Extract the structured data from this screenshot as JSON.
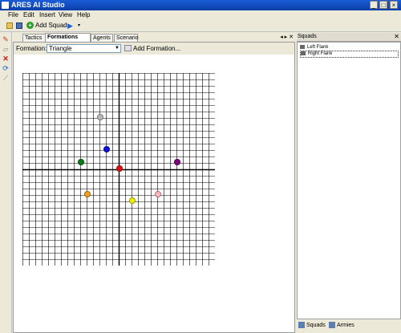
{
  "window": {
    "title": "ARES AI Studio"
  },
  "menu": [
    "File",
    "Edit",
    "Insert",
    "View",
    "Help"
  ],
  "toolbar": {
    "open_icon": "folder-open-icon",
    "save_icon": "save-icon",
    "add_squad": "Add Squad",
    "play_icon": "play-icon"
  },
  "tabs": [
    "Tactics",
    "Formations",
    "Agents",
    "Scenario"
  ],
  "active_tab": "Formations",
  "formations": {
    "label": "Formation:",
    "selected": "Triangle",
    "add_button": "Add Formation..."
  },
  "units": [
    {
      "color": "#b8b8b8",
      "selected": true
    },
    {
      "color": "#1010e0"
    },
    {
      "color": "#0a7a1a"
    },
    {
      "color": "#e01010"
    },
    {
      "color": "#800080"
    },
    {
      "color": "#f0a020"
    },
    {
      "color": "#ffb6c1"
    },
    {
      "color": "#f0f000"
    }
  ],
  "panel": {
    "title": "Squads",
    "squads": [
      "Left Flank",
      "Right Flank"
    ],
    "bottom_tabs": [
      "Squads",
      "Armies"
    ]
  }
}
